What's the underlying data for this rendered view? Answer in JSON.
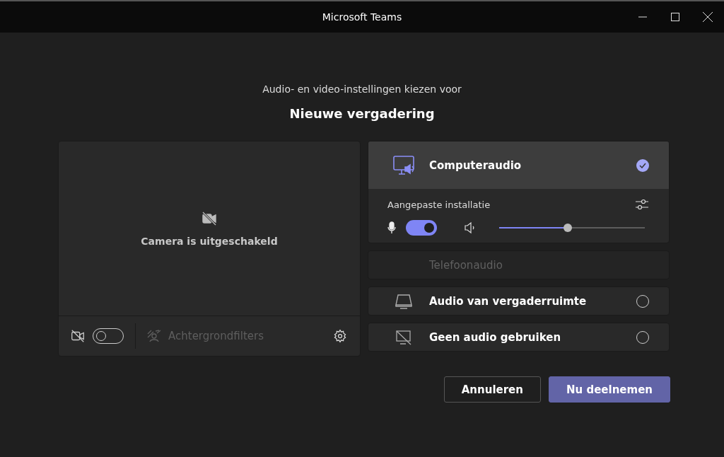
{
  "window": {
    "title": "Microsoft Teams"
  },
  "heading": {
    "subtitle": "Audio- en video-instellingen kiezen voor",
    "title": "Nieuwe vergadering"
  },
  "camera": {
    "message": "Camera is uitgeschakeld",
    "on": false,
    "filters_label": "Achtergrondfilters",
    "filters_disabled": true
  },
  "audio_options": [
    {
      "kind": "computer",
      "label": "Computeraudio",
      "selected": true,
      "disabled": false,
      "settings_label": "Aangepaste installatie",
      "mic_on": true,
      "volume": {
        "level": 0.47
      }
    },
    {
      "kind": "phone",
      "label": "Telefoonaudio",
      "selected": false,
      "disabled": true
    },
    {
      "kind": "room",
      "label": "Audio van vergaderruimte",
      "selected": false,
      "disabled": false
    },
    {
      "kind": "none",
      "label": "Geen audio gebruiken",
      "selected": false,
      "disabled": false
    }
  ],
  "buttons": [
    {
      "label": "Annuleren",
      "kind": "secondary"
    },
    {
      "label": "Nu deelnemen",
      "kind": "primary"
    }
  ]
}
